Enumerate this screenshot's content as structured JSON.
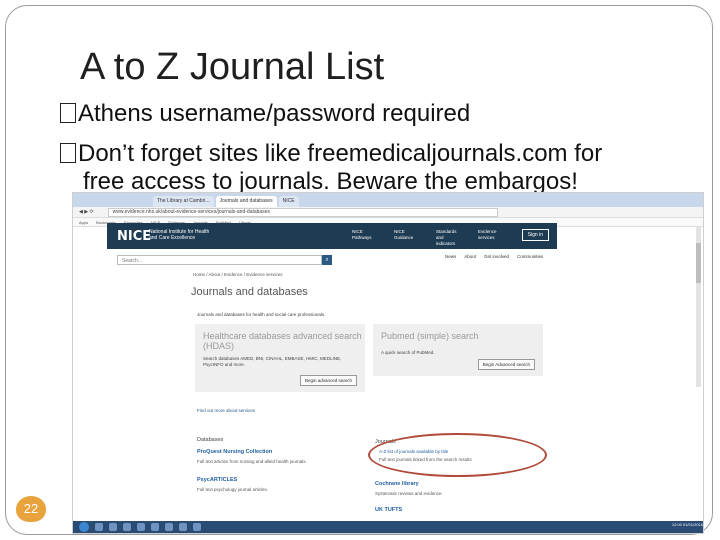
{
  "slide": {
    "title": "A to Z Journal List",
    "bullet_1": "Athens username/password required",
    "bullet_2_line1": "Don’t forget sites like freemedicaljournals.com for",
    "bullet_2_line2": "free access to journals. Beware the embargos!",
    "page_number": "22",
    "colors": {
      "page_number_badge": "#e8a33c",
      "frame": "#9a9a9a",
      "highlight_ellipse": "#b04a3a"
    }
  },
  "screenshot": {
    "tabs": [
      "The Library at Cambri...",
      "Journals and databases",
      "NICE"
    ],
    "address": "www.evidence.nhs.uk/about-evidence-services/journals-and-databases",
    "bookmarks": [
      "Apps",
      "Bookmarks",
      "Favourites",
      "NICE",
      "Evidence",
      "Journals",
      "PubMed",
      "Library"
    ],
    "header": {
      "logo": "NICE",
      "org": "National Institute for Health and Care Excellence",
      "nav": [
        "NICE Pathways",
        "NICE Guidance",
        "Standards and indicators",
        "Evidence services"
      ],
      "signin": "Sign in"
    },
    "search_placeholder": "Search...",
    "top_links": [
      "News",
      "About",
      "Get involved",
      "Communities"
    ],
    "breadcrumb": "Home  /  About  /  Evidence  /  Evidence services",
    "page_title": "Journals and databases",
    "intro": "Journals and databases for health and social care professionals.",
    "hdas": {
      "title": "Healthcare databases advanced search (HDAS)",
      "text": "Search databases AMED, BNI, CINAHL, EMBASE, HMIC, MEDLINE, PsycINFO and more.",
      "button": "Begin advanced search"
    },
    "pubmed": {
      "title": "Pubmed (simple) search",
      "text": "A quick search of PubMed.",
      "button": "Begin Advanced search"
    },
    "link_line": "Find out more about services",
    "left_col": {
      "head": "Databases",
      "link1": "ProQuest Nursing Collection",
      "text1": "Full text articles from nursing and allied health journals.",
      "link2": "PsycARTICLES",
      "text2": "Full text psychology journal articles."
    },
    "right_col": {
      "head": "Journals",
      "text1": "A-Z list of journals available by title",
      "text2": "Full text journals linked from the search results",
      "head2": "Cochrane library",
      "text3": "Systematic reviews and evidence.",
      "head3": "UK TUFTS"
    },
    "clock": "12:00 01/01/2016"
  }
}
